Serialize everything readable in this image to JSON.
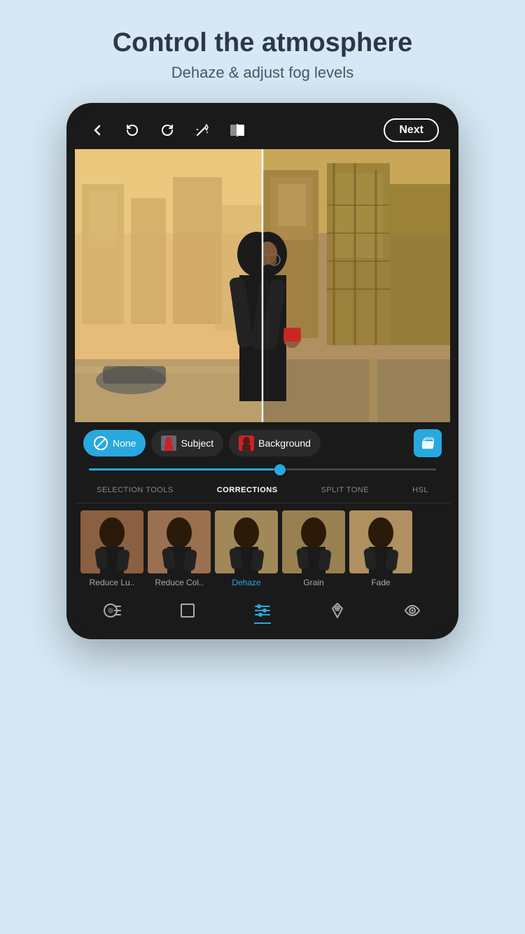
{
  "header": {
    "title": "Control the atmosphere",
    "subtitle": "Dehaze & adjust fog levels"
  },
  "topbar": {
    "next_label": "Next"
  },
  "selection": {
    "none_label": "None",
    "subject_label": "Subject",
    "background_label": "Background"
  },
  "tabs": {
    "items": [
      {
        "label": "SELECTION TOOLS",
        "active": false
      },
      {
        "label": "CORRECTIONS",
        "active": true
      },
      {
        "label": "SPLIT TONE",
        "active": false
      },
      {
        "label": "HSL",
        "active": false
      }
    ]
  },
  "corrections": [
    {
      "label": "Reduce Lu..",
      "active": false
    },
    {
      "label": "Reduce Col..",
      "active": false
    },
    {
      "label": "Dehaze",
      "active": true
    },
    {
      "label": "Grain",
      "active": false
    },
    {
      "label": "Fade",
      "active": false
    }
  ],
  "icons": {
    "back": "←",
    "undo": "↩",
    "redo": "↪",
    "magic": "✦",
    "compare": "⬛",
    "layers": "❏",
    "crop": "⊡",
    "sliders": "☰",
    "heal": "✚",
    "eye": "👁"
  }
}
